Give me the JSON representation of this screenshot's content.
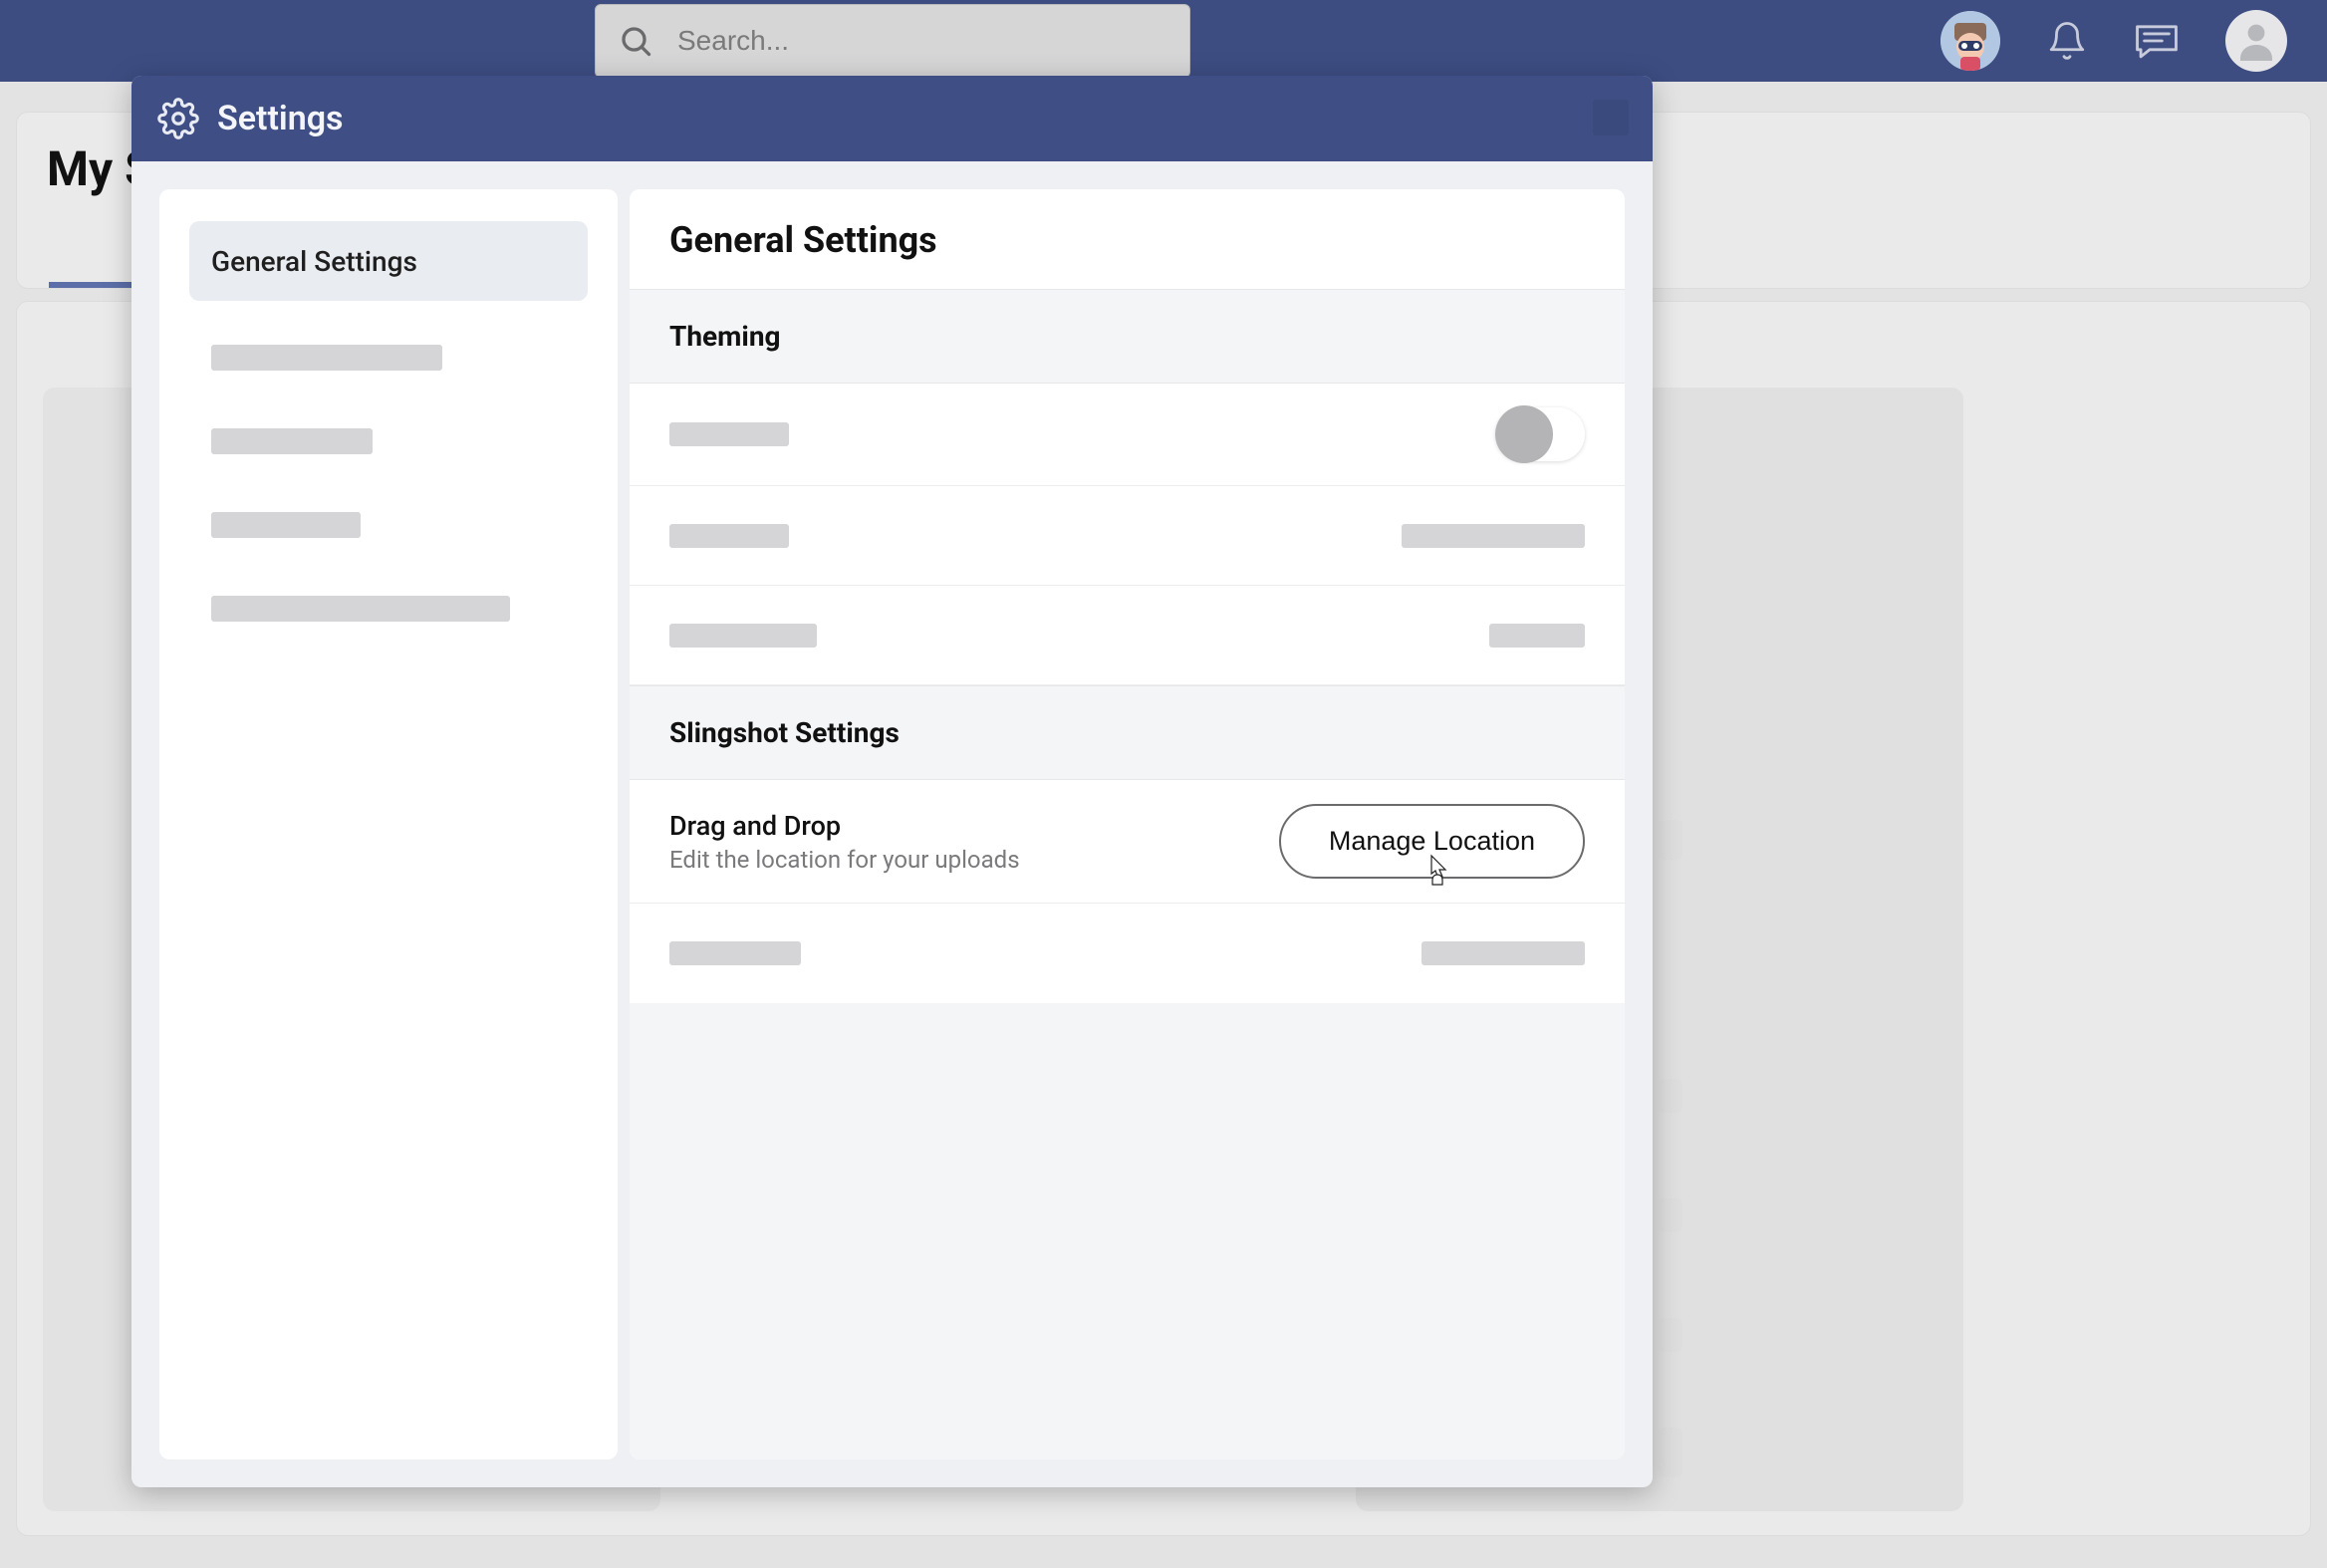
{
  "topbar": {
    "search_placeholder": "Search..."
  },
  "page": {
    "title_visible": "My S"
  },
  "modal": {
    "title": "Settings",
    "sidebar": {
      "active_item": "General Settings"
    },
    "content": {
      "title": "General Settings",
      "sections": {
        "theming": {
          "header": "Theming"
        },
        "slingshot": {
          "header": "Slingshot Settings",
          "drag_drop": {
            "title": "Drag and Drop",
            "subtitle": "Edit the location for your uploads",
            "button": "Manage Location"
          }
        }
      }
    }
  }
}
